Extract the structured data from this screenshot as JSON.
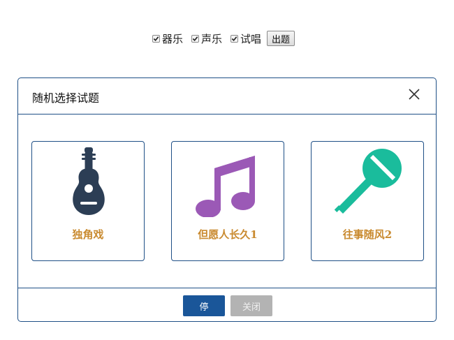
{
  "filters": [
    {
      "label": "器乐",
      "checked": true
    },
    {
      "label": "声乐",
      "checked": true
    },
    {
      "label": "试唱",
      "checked": true
    }
  ],
  "generate_button": "出题",
  "modal": {
    "title": "随机选择试题",
    "cards": [
      {
        "label": "独角戏",
        "icon": "guitar-icon",
        "color": "#2c3e55"
      },
      {
        "label": "但愿人长久1",
        "icon": "music-note-icon",
        "color": "#9b59b6"
      },
      {
        "label": "往事随风2",
        "icon": "microphone-icon",
        "color": "#1abc9c"
      }
    ],
    "stop_button": "停",
    "close_button": "关闭"
  },
  "colors": {
    "border": "#1e4f86",
    "card_label": "#c98a2f",
    "primary_button": "#1a5699",
    "disabled_button": "#b3b3b3"
  }
}
